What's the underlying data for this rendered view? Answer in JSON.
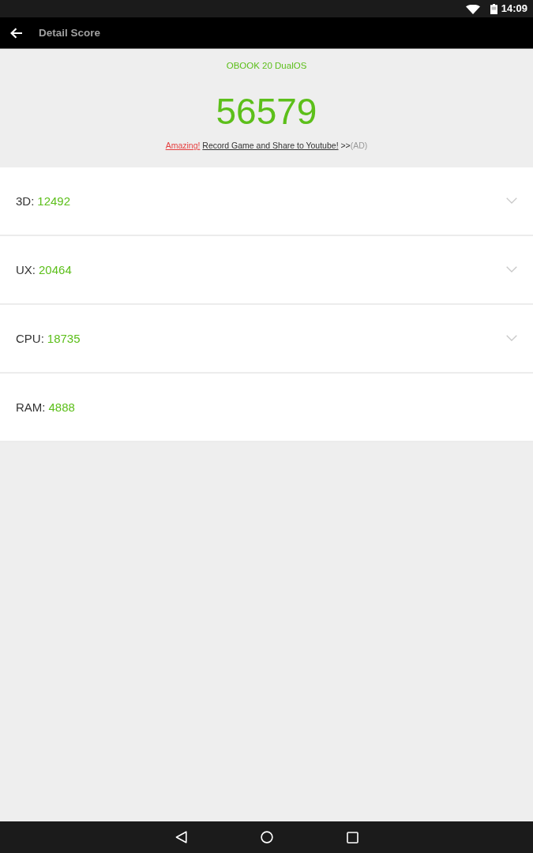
{
  "status_bar": {
    "time": "14:09"
  },
  "app_bar": {
    "title": "Detail Score"
  },
  "summary": {
    "device": "OBOOK 20 DualOS",
    "score": "56579",
    "promo": {
      "highlight": "Amazing!",
      "link": "Record Game and Share to Youtube!",
      "arrows": ">>",
      "tag": "(AD)"
    }
  },
  "scores": [
    {
      "label": "3D:",
      "value": "12492",
      "expandable": true
    },
    {
      "label": "UX:",
      "value": "20464",
      "expandable": true
    },
    {
      "label": "CPU:",
      "value": "18735",
      "expandable": true
    },
    {
      "label": "RAM:",
      "value": "4888",
      "expandable": false
    }
  ]
}
